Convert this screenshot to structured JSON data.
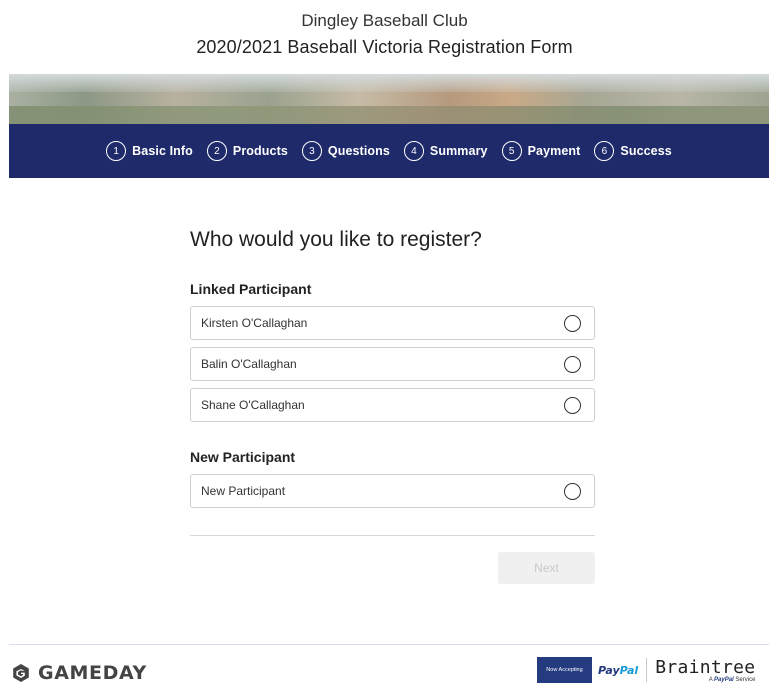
{
  "header": {
    "org_name": "Dingley Baseball Club",
    "form_title": "2020/2021 Baseball Victoria Registration Form"
  },
  "steps": [
    {
      "num": "1",
      "label": "Basic Info"
    },
    {
      "num": "2",
      "label": "Products"
    },
    {
      "num": "3",
      "label": "Questions"
    },
    {
      "num": "4",
      "label": "Summary"
    },
    {
      "num": "5",
      "label": "Payment"
    },
    {
      "num": "6",
      "label": "Success"
    }
  ],
  "form": {
    "question": "Who would you like to register?",
    "linked_label": "Linked Participant",
    "linked": [
      {
        "name": "Kirsten O'Callaghan"
      },
      {
        "name": "Balin O'Callaghan"
      },
      {
        "name": "Shane O'Callaghan"
      }
    ],
    "new_label": "New Participant",
    "new_option": "New Participant",
    "next_label": "Next"
  },
  "footer": {
    "brand": "GAMEDAY",
    "now_accepting": "Now Accepting",
    "paypal_pay": "Pay",
    "paypal_pal": "Pal",
    "braintree": "Braintree",
    "braintree_sub_prefix": "A",
    "braintree_sub_brand": "PayPal",
    "braintree_sub_suffix": "Service"
  },
  "colors": {
    "steps_bar": "#1f2a6b",
    "paypal_blue": "#253b80",
    "paypal_light": "#179bd7"
  }
}
